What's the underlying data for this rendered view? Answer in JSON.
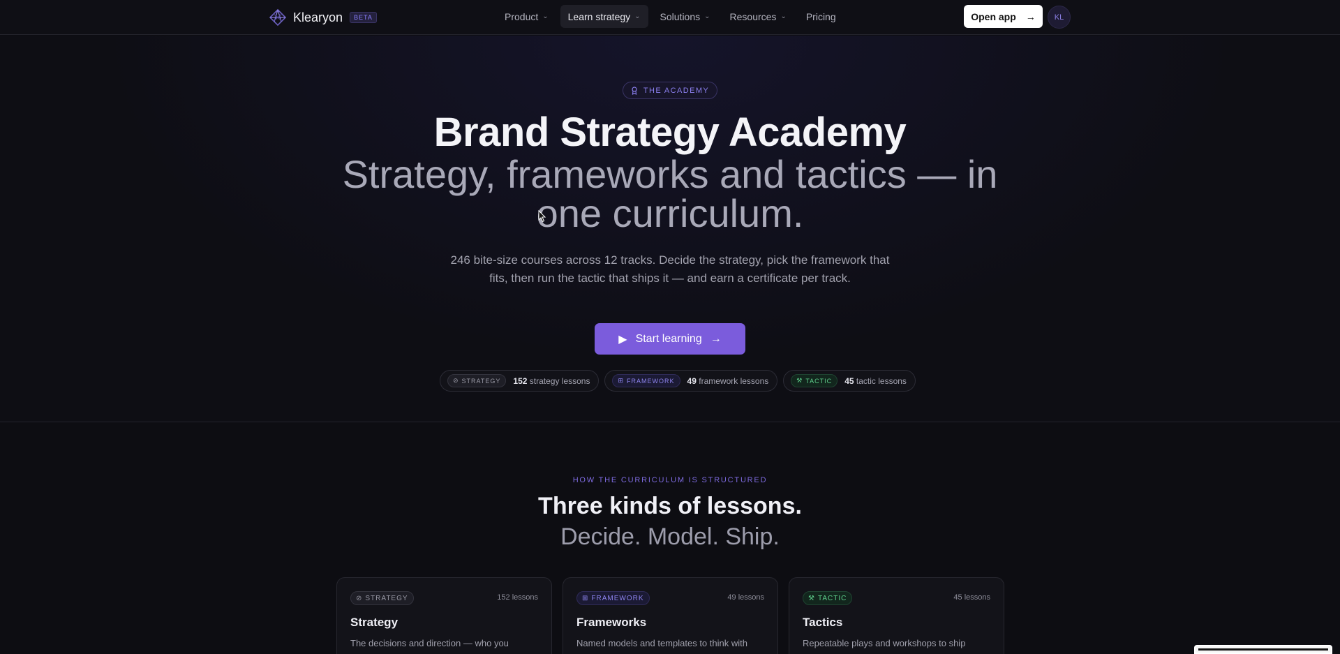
{
  "nav": {
    "brand_name": "Klearyon",
    "beta_badge": "BETA",
    "items": [
      {
        "label": "Product",
        "dropdown": true
      },
      {
        "label": "Learn strategy",
        "dropdown": true,
        "active": true
      },
      {
        "label": "Solutions",
        "dropdown": true
      },
      {
        "label": "Resources",
        "dropdown": true
      },
      {
        "label": "Pricing",
        "dropdown": false
      }
    ],
    "open_app_label": "Open app",
    "avatar_initials": "KL"
  },
  "hero": {
    "eyebrow": "THE ACADEMY",
    "title": "Brand Strategy Academy",
    "subtitle": "Strategy, frameworks and tactics — in one curriculum.",
    "lead": "246 bite-size courses across 12 tracks. Decide the strategy, pick the framework that fits, then run the tactic that ships it — and earn a certificate per track.",
    "cta_label": "Start learning",
    "chips": [
      {
        "tag": "STRATEGY",
        "count": "152",
        "label": "strategy lessons"
      },
      {
        "tag": "FRAMEWORK",
        "count": "49",
        "label": "framework lessons"
      },
      {
        "tag": "TACTIC",
        "count": "45",
        "label": "tactic lessons"
      }
    ]
  },
  "structure": {
    "kicker": "HOW THE CURRICULUM IS STRUCTURED",
    "heading": "Three kinds of lessons.",
    "subheading": "Decide. Model. Ship.",
    "cards": [
      {
        "tag": "STRATEGY",
        "count": "152 lessons",
        "title": "Strategy",
        "desc": "The decisions and direction — who you"
      },
      {
        "tag": "FRAMEWORK",
        "count": "49 lessons",
        "title": "Frameworks",
        "desc": "Named models and templates to think with"
      },
      {
        "tag": "TACTIC",
        "count": "45 lessons",
        "title": "Tactics",
        "desc": "Repeatable plays and workshops to ship"
      }
    ]
  },
  "colors": {
    "accent": "#7b5cdc",
    "background": "#0d0d12",
    "tactic_green": "#5fcf8c",
    "framework_purple": "#8e84ee"
  }
}
